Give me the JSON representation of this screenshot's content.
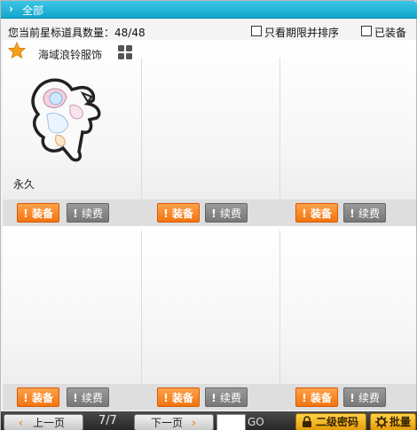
{
  "header": {
    "title": "全部"
  },
  "info": {
    "count_label": "您当前星标道具数量：48/48",
    "only_expiring_label": "只看期限并排序",
    "equipped_label": "已装备"
  },
  "item": {
    "name": "海域浪铃服饰",
    "duration": "永久"
  },
  "buttons": {
    "equip": "装备",
    "renew": "续费",
    "bang": "!"
  },
  "pagination": {
    "prev": "上一页",
    "next": "下一页",
    "page": "7/7",
    "go": "GO",
    "page_input": ""
  },
  "footer": {
    "secondary_password": "二级密码",
    "batch": "批量"
  },
  "colors": {
    "header": "#1bb3d8",
    "equip": "#f58a25",
    "renew": "#888888",
    "gold": "#f5b523"
  }
}
